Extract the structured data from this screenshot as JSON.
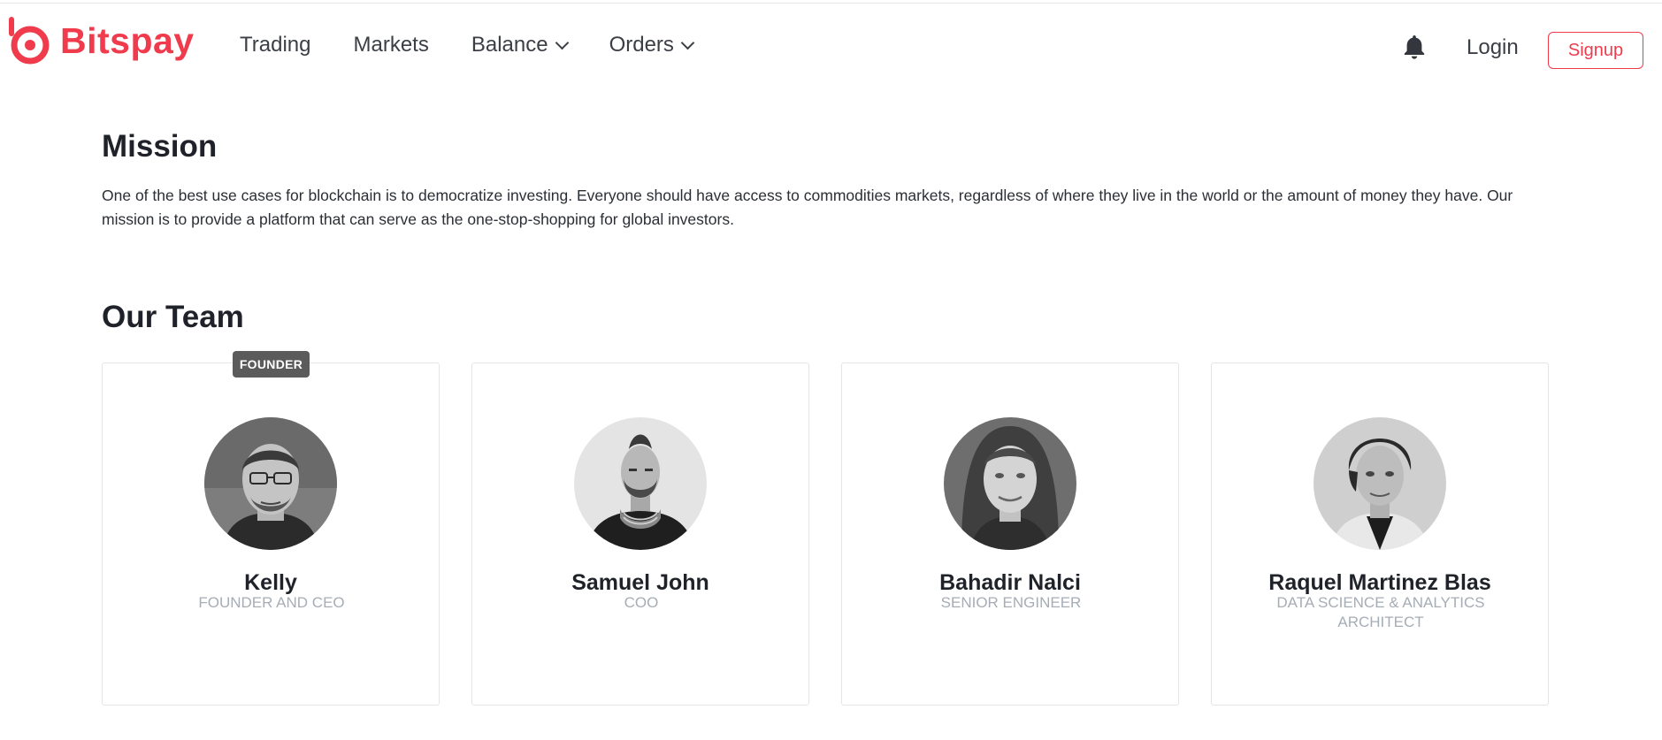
{
  "header": {
    "brand": "Bitspay",
    "nav": [
      {
        "label": "Trading",
        "has_dropdown": false
      },
      {
        "label": "Markets",
        "has_dropdown": false
      },
      {
        "label": "Balance",
        "has_dropdown": true
      },
      {
        "label": "Orders",
        "has_dropdown": true
      }
    ],
    "icons": {
      "notifications": "bell-icon",
      "dropdown": "chevron-down-icon",
      "logo": "bitspay-logo-icon"
    },
    "login_label": "Login",
    "signup_label": "Signup"
  },
  "mission": {
    "title": "Mission",
    "text": "One of the best use cases for blockchain is to democratize investing. Everyone should have access to commodities markets, regardless of where they live in the world or the amount of money they have. Our mission is to provide a platform that can serve as the one-stop-shopping for global investors."
  },
  "team": {
    "title": "Our Team",
    "members": [
      {
        "name": "Kelly",
        "role": "FOUNDER AND CEO",
        "badge": "FOUNDER"
      },
      {
        "name": "Samuel John",
        "role": "COO"
      },
      {
        "name": "Bahadir Nalci",
        "role": "SENIOR ENGINEER"
      },
      {
        "name": "Raquel Martinez Blas",
        "role": "DATA SCIENCE & ANALYTICS ARCHITECT"
      }
    ]
  },
  "colors": {
    "brand": "#ef3b4c",
    "text": "#222831",
    "muted": "#a6adb5",
    "badge_bg": "#5b5b5b",
    "card_border": "#e3e5e8"
  }
}
